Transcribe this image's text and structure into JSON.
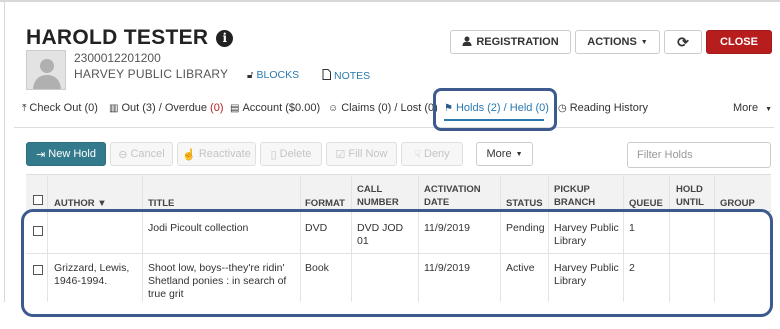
{
  "patron": {
    "name": "HAROLD TESTER",
    "info_icon": "i",
    "barcode": "2300012201200",
    "library": "HARVEY PUBLIC LIBRARY",
    "blocks_label": "BLOCKS",
    "notes_label": "NOTES"
  },
  "header_buttons": {
    "registration": "REGISTRATION",
    "actions": "ACTIONS",
    "refresh_icon": "refresh-icon",
    "close": "CLOSE"
  },
  "tabs": [
    {
      "label": "Check Out (0)",
      "icon": "upload-icon"
    },
    {
      "label": "Out (3) / Overdue",
      "overdue": "(0)",
      "icon": "books-icon"
    },
    {
      "label": "Account ($0.00)",
      "icon": "account-icon"
    },
    {
      "label": "Claims (0) / Lost (0)",
      "icon": "smile-icon"
    },
    {
      "label": "Holds (2) / Held (0)",
      "icon": "flag-icon",
      "active": true
    },
    {
      "label": "Reading History",
      "icon": "history-icon"
    }
  ],
  "more_tab": "More",
  "toolbar": {
    "new_hold": "New Hold",
    "cancel": "Cancel",
    "reactivate": "Reactivate",
    "delete": "Delete",
    "fill_now": "Fill Now",
    "deny": "Deny",
    "more": "More",
    "filter_placeholder": "Filter Holds"
  },
  "table": {
    "headers": {
      "author": "AUTHOR ▼",
      "title": "TITLE",
      "format": "FORMAT",
      "call_number": "CALL NUMBER",
      "activation_date": "ACTIVATION DATE",
      "status": "STATUS",
      "pickup_branch": "PICKUP BRANCH",
      "queue": "QUEUE",
      "hold_until": "HOLD UNTIL",
      "group": "GROUP"
    },
    "rows": [
      {
        "author": "",
        "title": "Jodi Picoult collection",
        "format": "DVD",
        "call_number": "DVD JOD 01",
        "activation_date": "11/9/2019",
        "status": "Pending",
        "pickup_branch": "Harvey Public Library",
        "queue": "1",
        "hold_until": "",
        "group": ""
      },
      {
        "author": "Grizzard, Lewis, 1946-1994.",
        "title": "Shoot low, boys--they're ridin' Shetland ponies : in search of true grit",
        "format": "Book",
        "call_number": "",
        "activation_date": "11/9/2019",
        "status": "Active",
        "pickup_branch": "Harvey Public Library",
        "queue": "2",
        "hold_until": "",
        "group": ""
      }
    ]
  },
  "colors": {
    "link": "#2a7ab0",
    "close_button": "#b81d1d",
    "new_hold_button": "#337a8c",
    "highlight": "#3d5a8e"
  }
}
